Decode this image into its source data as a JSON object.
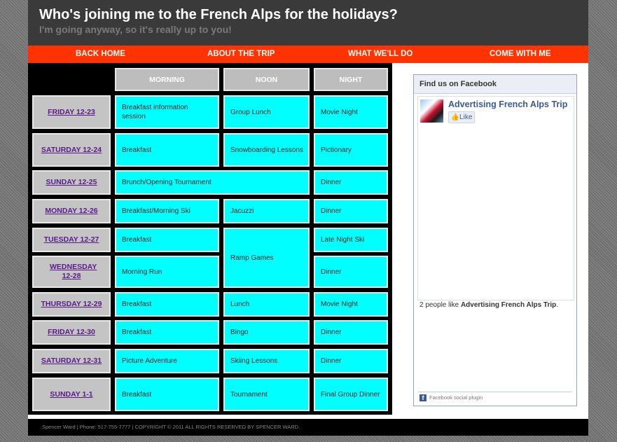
{
  "header": {
    "title": "Who's joining me to the French Alps for the holidays?",
    "tagline": "I'm going anyway, so it's really up to you!"
  },
  "nav": [
    "BACK HOME",
    "ABOUT THE TRIP",
    "WHAT WE'LL DO",
    "COME WITH ME"
  ],
  "schedule": {
    "columns": [
      "MORNING",
      "NOON",
      "NIGHT"
    ],
    "days": [
      "FRIDAY 12-23",
      "SATURDAY 12-24",
      "SUNDAY 12-25",
      "MONDAY 12-26",
      "TUESDAY 12-27",
      "WEDNESDAY 12-28",
      "THURSDAY 12-29",
      "FRIDAY 12-30",
      "SATURDAY 12-31",
      "SUNDAY 1-1"
    ],
    "activities": [
      "Breakfast information session",
      "Group Lunch",
      "Movie Night",
      "Breakfast",
      "Snowboarding Lessons",
      "Pictionary",
      "Brunch/Opening Tournament",
      "Dinner",
      "Breakfast/Morning Ski",
      "Jacuzzi",
      "Dinner",
      "Breakfast",
      "Ramp Games",
      "Late Night Ski",
      "Morning Run",
      "Dinner",
      "Breakfast",
      "Lunch",
      "Movie Night",
      "Breakfast",
      "Bingo",
      "Dinner",
      "Picture Adventure",
      "Skiing Lessons",
      "Dinner",
      "Breakfast",
      "Tournament",
      "Final Group Dinner"
    ]
  },
  "facebook": {
    "heading": "Find us on Facebook",
    "page_name": "Advertising French Alps Trip",
    "like_label": "Like",
    "like_count_prefix": "2 people like ",
    "like_count_page": "Advertising French Alps Trip",
    "like_count_suffix": ".",
    "plugin_label": "Facebook social plugin",
    "logo_letter": "f",
    "like_icon": "thumbs-up-icon"
  },
  "footer": {
    "text": "Spencer Ward | Phone: 517-755-7777 | COPYRIGHT © 2011 ALL RIGHTS RESERVED BY SPENCER WARD."
  },
  "colors": {
    "header_bg": "#3a3a3a",
    "nav_bg": "#ff3300",
    "activity_cell": "#00ffff",
    "day_cell": "#c4c4c4",
    "day_link": "#5a1a8a",
    "fb_blue": "#3b5998"
  }
}
